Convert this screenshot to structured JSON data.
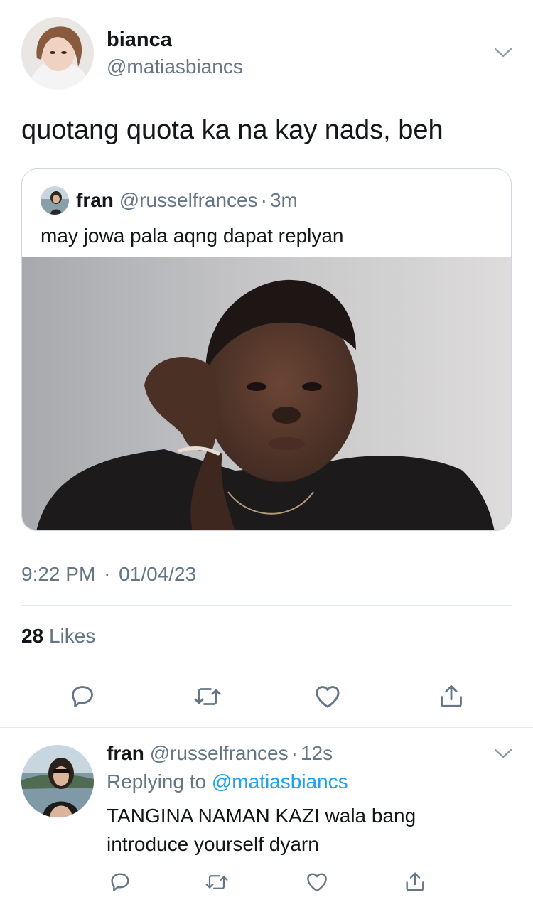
{
  "tweet": {
    "author": {
      "display_name": "bianca",
      "handle": "@matiasbiancs"
    },
    "text": "quotang quota ka na kay nads, beh",
    "quoted": {
      "author": {
        "display_name": "fran",
        "handle": "@russelfrances",
        "time": "3m"
      },
      "text": "may jowa pala aqng dapat replyan"
    },
    "timestamp": {
      "time": "9:22 PM",
      "date": "01/04/23"
    },
    "likes": {
      "count": "28",
      "label": "Likes"
    }
  },
  "reply": {
    "author": {
      "display_name": "fran",
      "handle": "@russelfrances",
      "time": "12s"
    },
    "replying_to_label": "Replying to",
    "replying_to_handle": "@matiasbiancs",
    "text_line1": "TANGINA NAMAN KAZI wala bang",
    "text_line2": "introduce yourself dyarn"
  },
  "separator": "·",
  "icons": [
    "chevron-down-icon",
    "reply-icon",
    "retweet-icon",
    "like-icon",
    "share-icon"
  ],
  "colors": {
    "text": "#14171a",
    "muted": "#657786",
    "link": "#1da1f2",
    "divider": "#e1e8ed"
  }
}
